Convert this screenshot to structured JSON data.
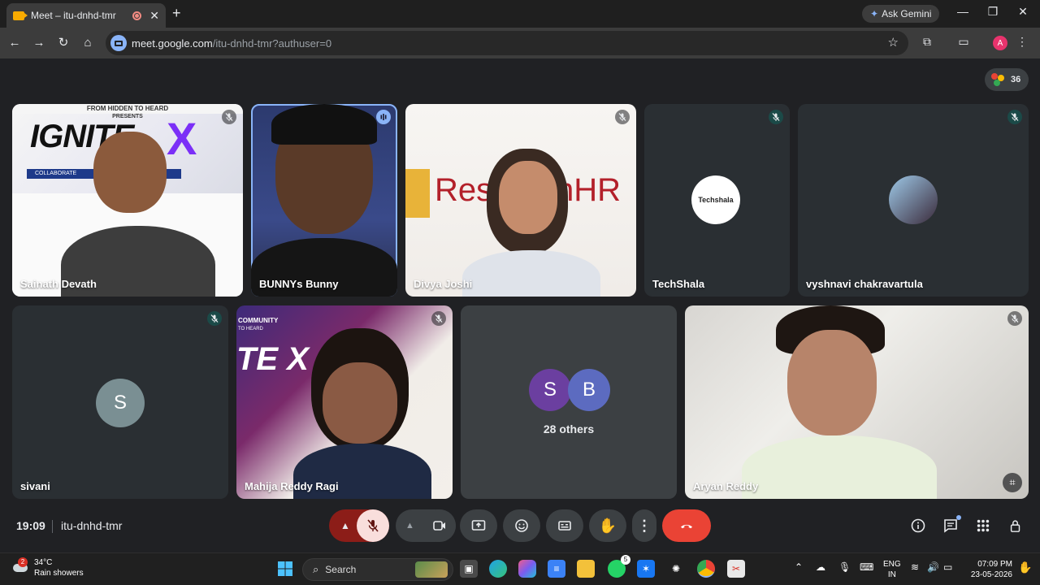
{
  "browser": {
    "tab_title": "Meet – itu-dnhd-tmr",
    "new_tab": "+",
    "ask_gemini": "Ask Gemini",
    "url_host": "meet.google.com",
    "url_path": "/itu-dnhd-tmr?authuser=0",
    "profile_initial": "A"
  },
  "meet": {
    "participant_count": "36",
    "participants": [
      {
        "name": "Sainath Devath",
        "muted": true
      },
      {
        "name": "BUNNYs Bunny",
        "muted": false,
        "speaking": true
      },
      {
        "name": "Divya Joshi",
        "muted": true
      },
      {
        "name": "TechShala",
        "muted": true
      },
      {
        "name": "vyshnavi chakravartula",
        "muted": true
      },
      {
        "name": "sivani",
        "muted": true,
        "initial": "S"
      },
      {
        "name": "Mahija Reddy Ragi",
        "muted": true
      },
      {
        "name": "Aryan Reddy",
        "muted": true
      }
    ],
    "others": {
      "label": "28 others",
      "initials": [
        "S",
        "B"
      ]
    },
    "backdrop_text": {
      "banner_top": "FROM HIDDEN TO HEARD",
      "banner_presents": "PRESENTS",
      "banner_title": "IGNITE",
      "banner_sub": "COLLABORATE",
      "research_logo": "ResearchHR",
      "techshala_logo": "Techshala",
      "community": "COMMUNITY",
      "to_heard": "TO HEARD"
    },
    "time": "19:09",
    "meeting_code": "itu-dnhd-tmr"
  },
  "taskbar": {
    "temperature": "34°C",
    "weather": "Rain showers",
    "weather_badge": "2",
    "search": "Search",
    "whatsapp_badge": "5",
    "lang_top": "ENG",
    "lang_bottom": "IN",
    "clock_time": "07:09 PM",
    "clock_date": "23-05-2026"
  },
  "colors": {
    "meet_bg": "#202124",
    "end_call": "#ea4335",
    "muted_red": "#f9dedc",
    "avatar_s": "#6b3fa0",
    "avatar_b": "#5c6bc0"
  }
}
